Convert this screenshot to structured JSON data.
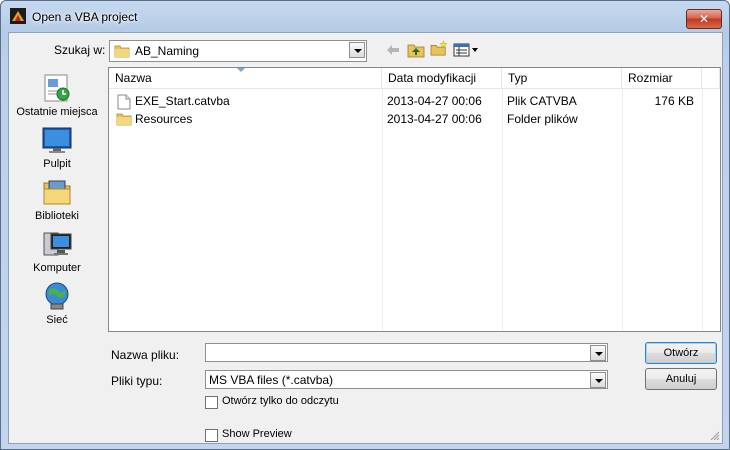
{
  "window": {
    "title": "Open a VBA project",
    "close_label": "✕"
  },
  "toolbar": {
    "lookin_label": "Szukaj w:",
    "lookin_value": "AB_Naming",
    "back_icon": "back-arrow-icon",
    "up_icon": "up-folder-icon",
    "new_folder_icon": "new-folder-icon",
    "view_menu_icon": "view-menu-icon"
  },
  "places": [
    {
      "label": "Ostatnie miejsca",
      "icon": "recent-places-icon"
    },
    {
      "label": "Pulpit",
      "icon": "desktop-icon"
    },
    {
      "label": "Biblioteki",
      "icon": "libraries-icon"
    },
    {
      "label": "Komputer",
      "icon": "computer-icon"
    },
    {
      "label": "Sieć",
      "icon": "network-icon"
    }
  ],
  "filelist": {
    "columns": [
      "Nazwa",
      "Data modyfikacji",
      "Typ",
      "Rozmiar"
    ],
    "rows": [
      {
        "name": "EXE_Start.catvba",
        "date": "2013-04-27 00:06",
        "type": "Plik CATVBA",
        "size": "176 KB",
        "icon": "file-icon"
      },
      {
        "name": "Resources",
        "date": "2013-04-27 00:06",
        "type": "Folder plików",
        "size": "",
        "icon": "folder-icon"
      }
    ]
  },
  "form": {
    "filename_label": "Nazwa pliku:",
    "filename_value": "",
    "filetype_label": "Pliki typu:",
    "filetype_value": "MS VBA files (*.catvba)",
    "readonly_label": "Otwórz tylko do odczytu",
    "readonly_checked": false,
    "preview_label": "Show Preview",
    "preview_checked": false
  },
  "buttons": {
    "open": "Otwórz",
    "cancel": "Anuluj"
  },
  "colors": {
    "title_gradient_top": "#c6d9f0",
    "close_red": "#c0391e",
    "folder_yellow": "#e8c25a"
  }
}
